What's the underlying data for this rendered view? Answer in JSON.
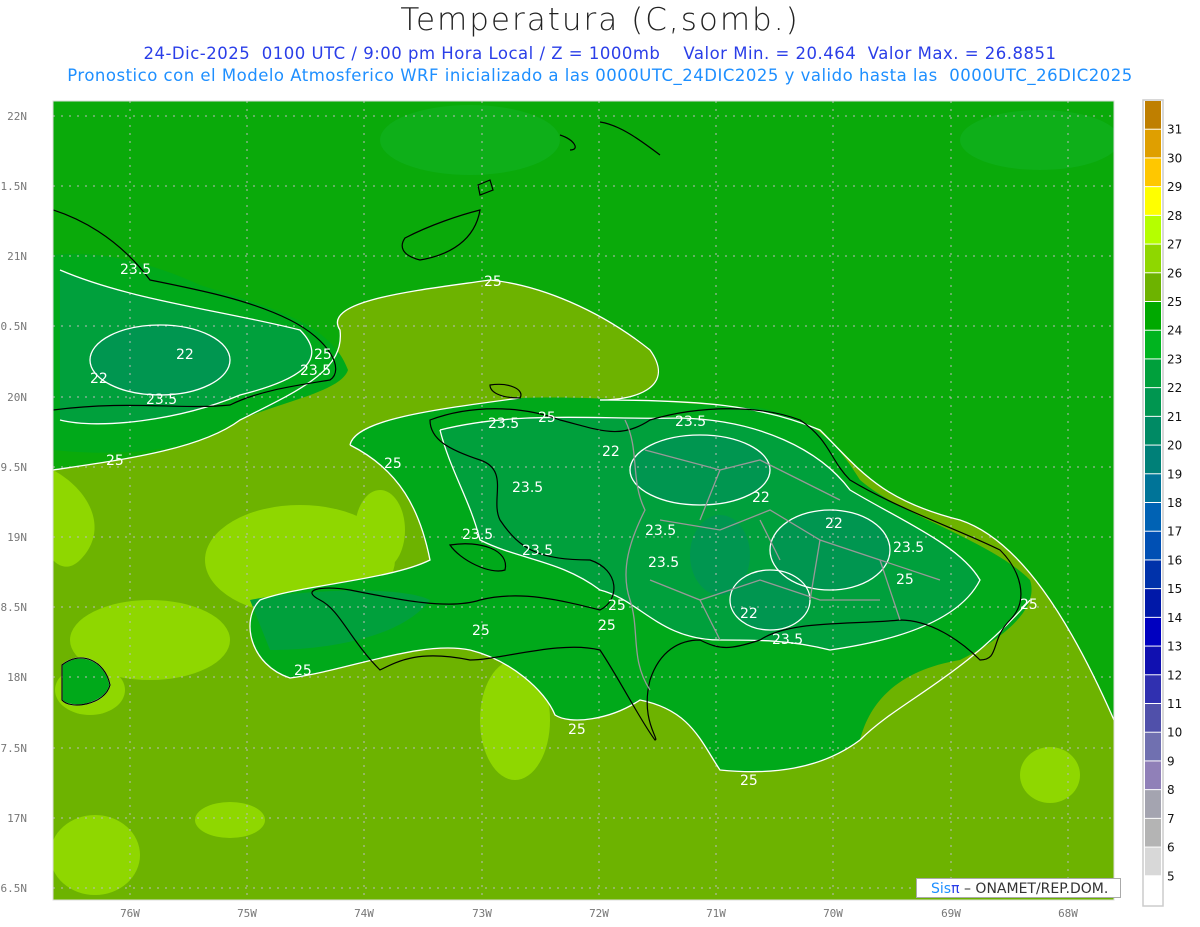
{
  "header": {
    "title": "Temperatura (C,somb.)",
    "subtitle": "24-Dic-2025  0100 UTC / 9:00 pm Hora Local / Z = 1000mb    Valor Min. = 20.464  Valor Max. = 26.8851",
    "description": "Pronostico con el Modelo Atmosferico WRF inicializado a las 0000UTC_24DIC2025 y valido hasta las  0000UTC_26DIC2025"
  },
  "axes": {
    "lon_labels": [
      "76W",
      "75W",
      "74W",
      "73W",
      "72W",
      "71W",
      "70W",
      "69W",
      "68W"
    ],
    "lat_labels": [
      "22N",
      "1.5N",
      "21N",
      "0.5N",
      "20N",
      "9.5N",
      "19N",
      "8.5N",
      "18N",
      "7.5N",
      "17N",
      "6.5N"
    ]
  },
  "colorbar": {
    "labels": [
      "31",
      "30",
      "29",
      "28",
      "27",
      "26",
      "25",
      "24",
      "23",
      "22",
      "21",
      "20",
      "19",
      "18",
      "17",
      "16",
      "15",
      "14",
      "13",
      "12",
      "11",
      "10",
      "9",
      "8",
      "7",
      "6",
      "5"
    ],
    "colors": [
      "#bf7f00",
      "#df9f00",
      "#ffc700",
      "#ffff00",
      "#b5ff00",
      "#8fd700",
      "#6db300",
      "#00a900",
      "#00b41f",
      "#00a03c",
      "#009650",
      "#008a64",
      "#008078",
      "#007498",
      "#0062b4",
      "#0050b4",
      "#0032aa",
      "#0018a8",
      "#0000c0",
      "#1010b0",
      "#3030b0",
      "#5050aa",
      "#7070b0",
      "#9080b8",
      "#a4a4b0",
      "#b4b4b4",
      "#d8d8d8",
      "#ffffff"
    ]
  },
  "contour_labels": [
    "23.5",
    "22",
    "22",
    "23.5",
    "25",
    "23.5",
    "25",
    "25",
    "23.5",
    "25",
    "23.5",
    "22",
    "23.5",
    "22",
    "22",
    "23.5",
    "23.5",
    "23.5",
    "23.5",
    "22",
    "23.5",
    "25",
    "25",
    "25",
    "25",
    "25",
    "25",
    "25",
    "25",
    "25",
    "23.5"
  ],
  "credit": {
    "sis": "Sis",
    "pi": "π",
    "rest": "– ONAMET/REP.DOM."
  },
  "chart_data": {
    "type": "heatmap",
    "title": "Temperatura (C,somb.)",
    "variable": "Temperature at 1000mb",
    "units": "C",
    "value_min": 20.464,
    "value_max": 26.8851,
    "lon_range": [
      "76.6W",
      "67.6W"
    ],
    "lat_range": [
      "16.4N",
      "22.1N"
    ],
    "contour_levels": [
      22,
      23.5,
      25
    ],
    "colorbar_range": [
      5,
      31
    ]
  }
}
